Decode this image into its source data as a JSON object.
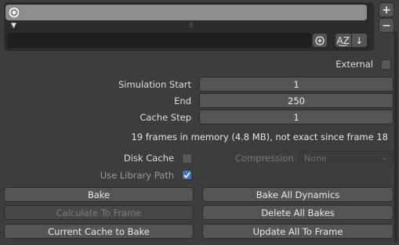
{
  "cache_list": {
    "items": [
      {
        "name": ""
      }
    ],
    "filter_placeholder": "",
    "sort_alpha_label": "A͜Z",
    "sort_order_label": "↓"
  },
  "external": {
    "label": "External",
    "checked": false
  },
  "fields": {
    "simulation_start": {
      "label": "Simulation Start",
      "value": "1"
    },
    "end": {
      "label": "End",
      "value": "250"
    },
    "cache_step": {
      "label": "Cache Step",
      "value": "1"
    }
  },
  "info": "19 frames in memory (4.8 MB), not exact since frame 18",
  "disk_cache": {
    "label": "Disk Cache",
    "checked": false
  },
  "compression": {
    "label": "Compression",
    "value": "None"
  },
  "use_library_path": {
    "label": "Use Library Path",
    "checked": true
  },
  "buttons": {
    "bake": "Bake",
    "bake_all_dynamics": "Bake All Dynamics",
    "calculate_to_frame": "Calculate To Frame",
    "delete_all_bakes": "Delete All Bakes",
    "current_cache_to_bake": "Current Cache to Bake",
    "update_all_to_frame": "Update All To Frame"
  },
  "colors": {
    "accent": "#4772b3",
    "panel_bg": "#3d3d3d",
    "list_item": "#8d8d8d"
  }
}
